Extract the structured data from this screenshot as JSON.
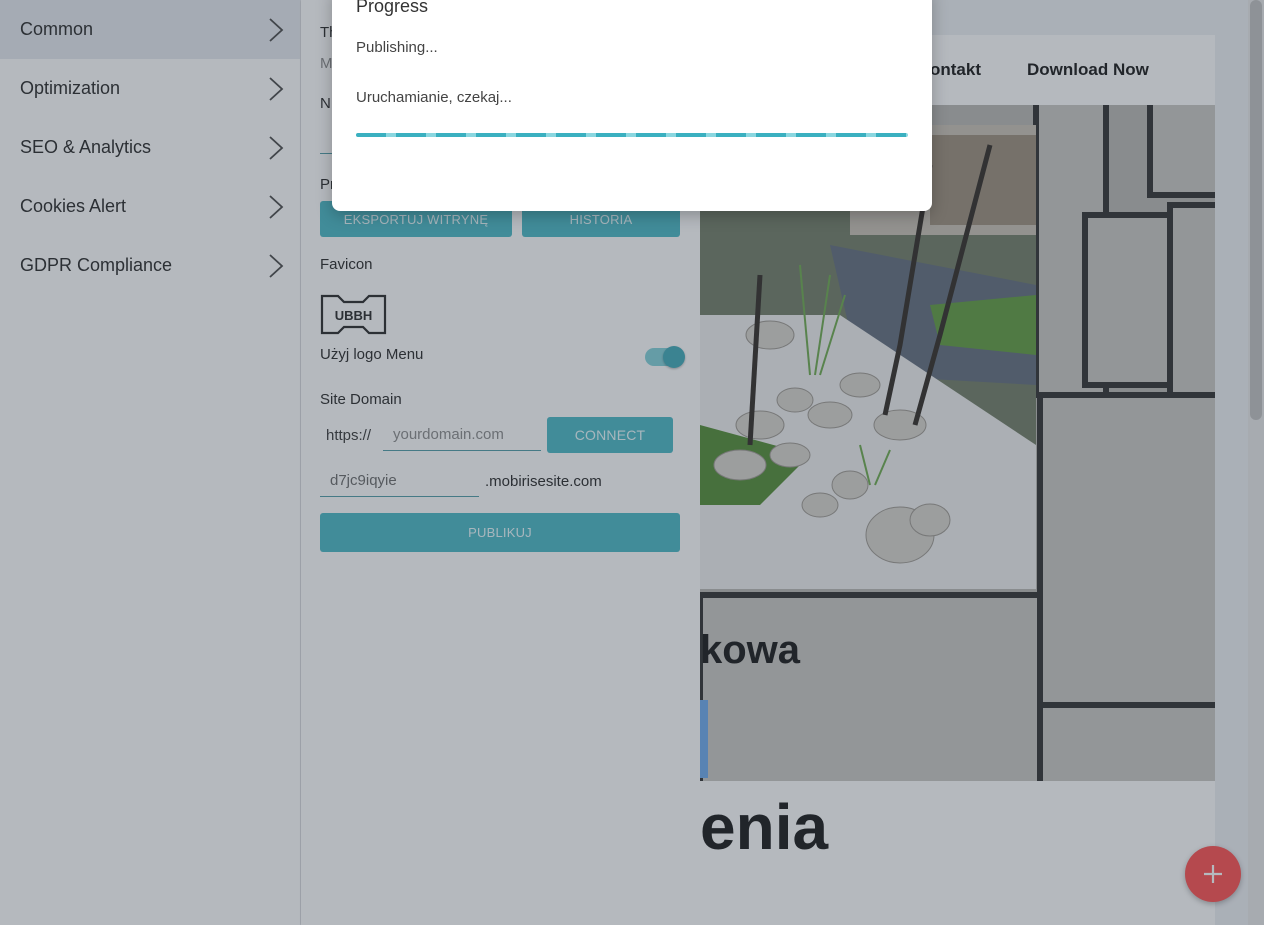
{
  "sidebar": {
    "items": [
      {
        "label": "Common",
        "active": true
      },
      {
        "label": "Optimization"
      },
      {
        "label": "SEO & Analytics"
      },
      {
        "label": "Cookies Alert"
      },
      {
        "label": "GDPR Compliance"
      }
    ]
  },
  "panel": {
    "clipped_labels": [
      "Th",
      "M",
      "N",
      "Pr"
    ],
    "export_button": "EKSPORTUJ WITRYNĘ",
    "history_button": "HISTORIA",
    "favicon_label": "Favicon",
    "favicon_logo_text": "UBBH",
    "use_logo_label": "Użyj logo Menu",
    "use_logo_enabled": true,
    "site_domain_label": "Site Domain",
    "https_prefix": "https://",
    "domain_placeholder": "yourdomain.com",
    "connect_button": "CONNECT",
    "subdomain_value": "d7jc9iqyie",
    "subdomain_suffix": ".mobirisesite.com",
    "publish_button": "PUBLIKUJ"
  },
  "preview": {
    "nav_links": [
      "ontakt",
      "Download Now"
    ],
    "headline_1": "kowa",
    "headline_2": "enia"
  },
  "modal": {
    "title": "Progress",
    "status": "Publishing...",
    "message": "Uruchamianie, czekaj...",
    "progress_percent": 100
  },
  "colors": {
    "accent": "#45b6c4",
    "fab": "#ff4b4b",
    "overlay": "rgba(60,70,85,0.38)"
  },
  "icons": {
    "nav_chevron": "chevron-right-icon",
    "fab": "plus-icon"
  }
}
